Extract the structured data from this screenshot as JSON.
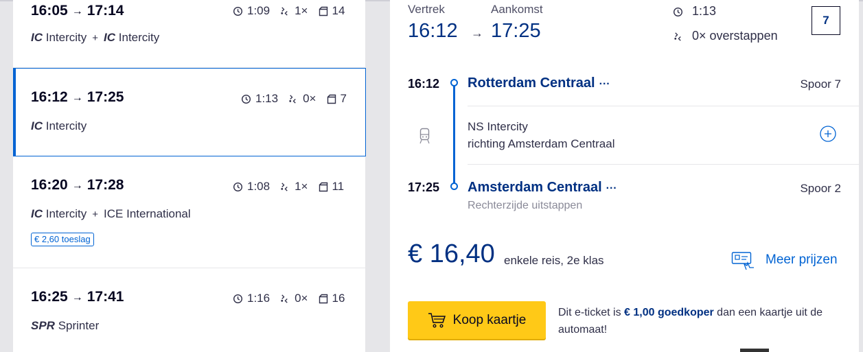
{
  "trips": [
    {
      "dep": "16:05",
      "arr": "17:14",
      "duration": "1:09",
      "transfers": "1×",
      "platform": "14",
      "trains": [
        {
          "code": "IC",
          "name": "Intercity"
        },
        {
          "code": "IC",
          "name": "Intercity"
        }
      ],
      "surcharge": null
    },
    {
      "dep": "16:12",
      "arr": "17:25",
      "duration": "1:13",
      "transfers": "0×",
      "platform": "7",
      "trains": [
        {
          "code": "IC",
          "name": "Intercity"
        }
      ],
      "surcharge": null
    },
    {
      "dep": "16:20",
      "arr": "17:28",
      "duration": "1:08",
      "transfers": "1×",
      "platform": "11",
      "trains": [
        {
          "code": "IC",
          "name": "Intercity"
        },
        {
          "code": "",
          "name": "ICE International"
        }
      ],
      "surcharge": "€ 2,60 toeslag"
    },
    {
      "dep": "16:25",
      "arr": "17:41",
      "duration": "1:16",
      "transfers": "0×",
      "platform": "16",
      "trains": [
        {
          "code": "SPR",
          "name": "Sprinter"
        }
      ],
      "surcharge": null
    }
  ],
  "detail": {
    "departure_label": "Vertrek",
    "arrival_label": "Aankomst",
    "departure_time": "16:12",
    "arrival_time": "17:25",
    "duration": "1:13",
    "transfers_text": "0× overstappen",
    "platform": "7",
    "from": {
      "time": "16:12",
      "station": "Rotterdam Centraal",
      "dots": "···",
      "platform": "Spoor 7"
    },
    "leg": {
      "operator": "NS Intercity",
      "direction": "richting Amsterdam Centraal"
    },
    "to": {
      "time": "17:25",
      "station": "Amsterdam Centraal",
      "dots": "···",
      "platform": "Spoor 2",
      "note": "Rechterzijde uitstappen"
    },
    "price": "€ 16,40",
    "price_note": "enkele reis, 2e klas",
    "more_prices": "Meer prijzen",
    "buy_label": "Koop kaartje",
    "eticket_pre": "Dit e-ticket is ",
    "eticket_bold": "€ 1,00 goedkoper",
    "eticket_post": " dan een kaartje uit de automaat!"
  },
  "colors": {
    "ns_blue": "#003082",
    "link_blue": "#0063d3",
    "yellow": "#ffc917",
    "background": "#e6e6e9"
  },
  "icons": {
    "duration": "clock-icon",
    "transfers": "transfer-icon",
    "platform": "platform-icon",
    "train": "train-icon",
    "expand": "plus-circle-icon",
    "prices": "ticket-icon",
    "cart": "cart-icon",
    "arrow": "arrow-right-icon"
  }
}
